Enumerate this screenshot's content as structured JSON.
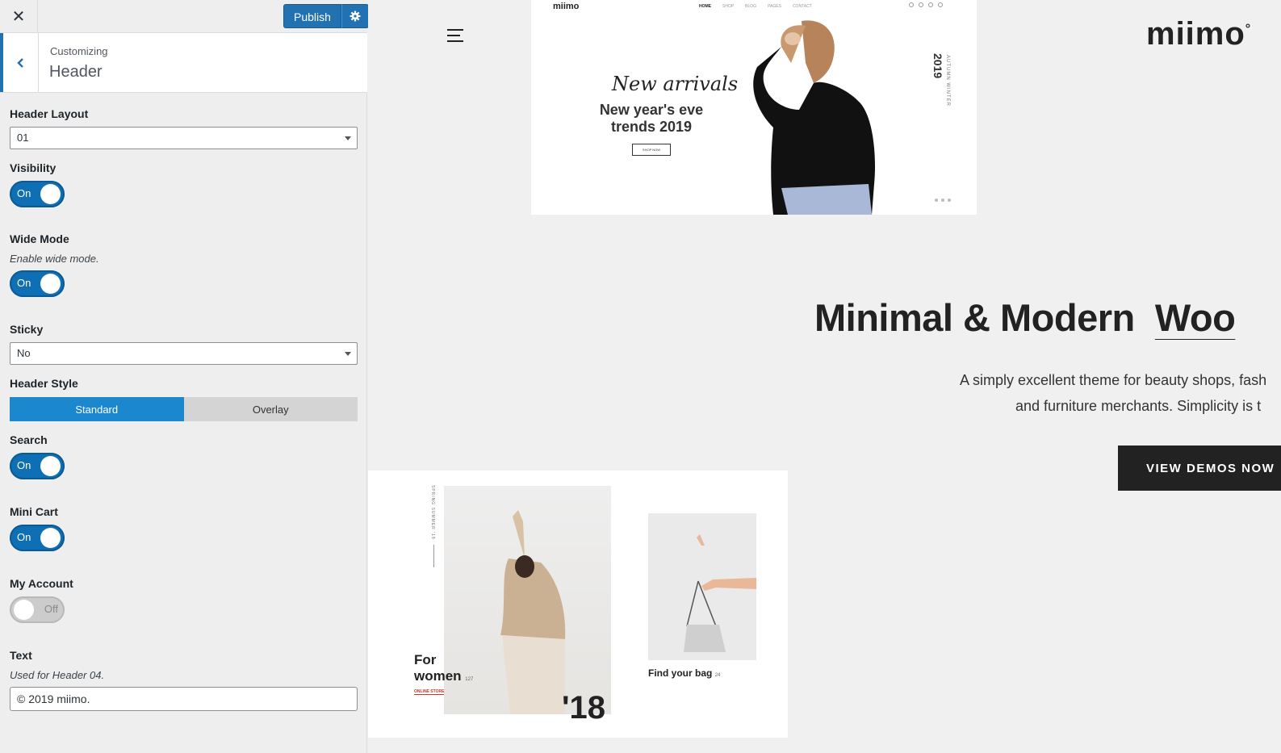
{
  "topbar": {
    "close_label": "✕",
    "publish_label": "Publish"
  },
  "section": {
    "crumb": "Customizing",
    "title": "Header"
  },
  "controls": {
    "header_layout": {
      "label": "Header Layout",
      "value": "01"
    },
    "visibility": {
      "label": "Visibility",
      "state": "On"
    },
    "wide_mode": {
      "label": "Wide Mode",
      "description": "Enable wide mode.",
      "state": "On"
    },
    "sticky": {
      "label": "Sticky",
      "value": "No"
    },
    "header_style": {
      "label": "Header Style",
      "options": [
        "Standard",
        "Overlay"
      ],
      "selected": "Standard"
    },
    "search": {
      "label": "Search",
      "state": "On"
    },
    "mini_cart": {
      "label": "Mini Cart",
      "state": "On"
    },
    "my_account": {
      "label": "My Account",
      "state": "Off"
    },
    "text": {
      "label": "Text",
      "description": "Used for Header 04.",
      "value": "© 2019 miimo."
    }
  },
  "preview": {
    "logo": "miimo",
    "hero": {
      "logo": "miimo",
      "nav": [
        "HOME",
        "SHOP",
        "BLOG",
        "PAGES",
        "CONTACT"
      ],
      "script": "New arrivals",
      "promo": "New year's eve trends 2019",
      "button": "SHOP NOW",
      "year": "2019",
      "season": "AUTUMN WINTER"
    },
    "tagline": "Minimal & Modern",
    "tagline_emphasis": "Woo",
    "description_line1": "A simply excellent theme for beauty shops, fash",
    "description_line2": "and furniture merchants. Simplicity is t",
    "cta": "VIEW DEMOS NOW",
    "shop": {
      "season": "SPRING SUMMER '18",
      "women_line1": "For",
      "women_line2": "women",
      "women_count": "127",
      "women_sub": "ONLINE STORE",
      "year": "'18",
      "bag_label": "Find your bag",
      "bag_count": "24"
    }
  },
  "colors": {
    "accent": "#2271b1",
    "toggle_on": "#0f6fb5",
    "segment_active": "#1b87cf",
    "cta_bg": "#222222"
  },
  "icons": {
    "close": "close-icon",
    "gear": "gear-icon",
    "back": "chevron-left-icon",
    "menu": "hamburger-icon"
  }
}
